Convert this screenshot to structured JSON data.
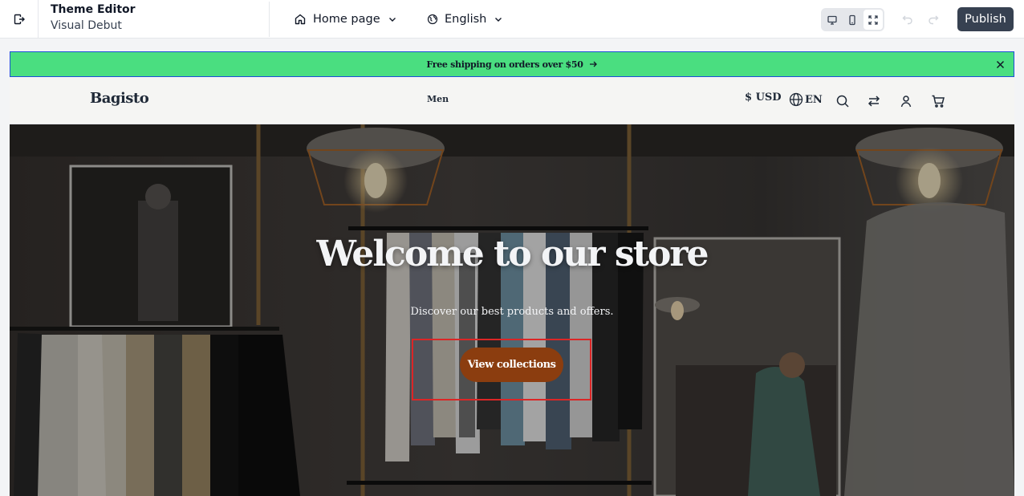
{
  "editor": {
    "title": "Theme Editor",
    "subtitle": "Visual Debut",
    "page_select": {
      "value": "Home page",
      "icon": "home-icon"
    },
    "language_select": {
      "value": "English",
      "icon": "globe-icon"
    },
    "devices": [
      {
        "name": "desktop",
        "icon": "desktop-icon",
        "active": false
      },
      {
        "name": "mobile",
        "icon": "mobile-icon",
        "active": false
      },
      {
        "name": "fullscreen",
        "icon": "fullscreen-icon",
        "active": true
      }
    ],
    "publish_label": "Publish"
  },
  "preview": {
    "announcement": {
      "text": "Free shipping on orders over $50",
      "color": "#4ade80"
    },
    "header": {
      "logo": "Bagisto",
      "nav": [
        "Men"
      ],
      "currency": "$ USD",
      "locale": "EN",
      "icons": [
        "search-icon",
        "compare-icon",
        "user-icon",
        "cart-icon"
      ]
    },
    "hero": {
      "title": "Welcome to our store",
      "subtitle": "Discover our best products and offers.",
      "cta_label": "View collections",
      "cta_color": "#8b3d0f"
    }
  }
}
